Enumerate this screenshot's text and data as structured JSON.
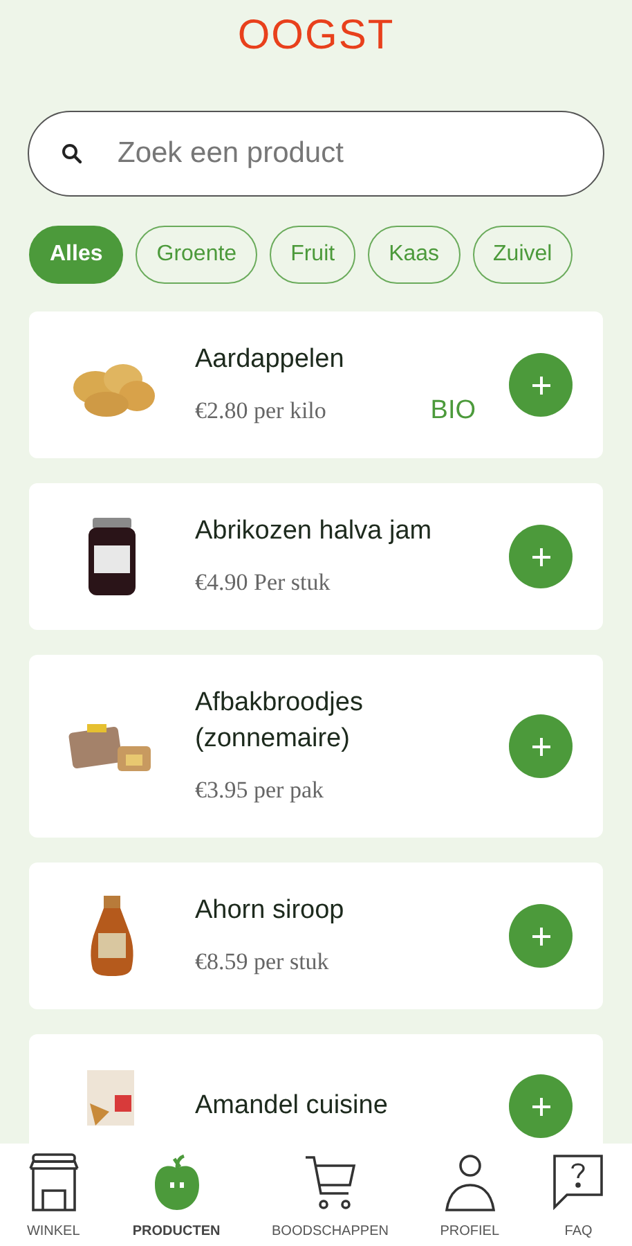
{
  "logo": "OOGST",
  "search": {
    "placeholder": "Zoek een product"
  },
  "filters": [
    {
      "label": "Alles",
      "selected": true
    },
    {
      "label": "Groente",
      "selected": false
    },
    {
      "label": "Fruit",
      "selected": false
    },
    {
      "label": "Kaas",
      "selected": false
    },
    {
      "label": "Zuivel",
      "selected": false
    }
  ],
  "products": [
    {
      "name": "Aardappelen",
      "price": "€2.80 per kilo",
      "badge": "BIO"
    },
    {
      "name": "Abrikozen halva jam",
      "price": "€4.90 Per stuk"
    },
    {
      "name": "Afbakbroodjes (zonnemaire)",
      "price": "€3.95 per pak"
    },
    {
      "name": "Ahorn siroop",
      "price": "€8.59 per stuk"
    },
    {
      "name": "Amandel cuisine"
    }
  ],
  "bottom_nav": [
    {
      "kind": "shop",
      "label": "WINKEL",
      "selected": false
    },
    {
      "kind": "apple",
      "label": "PRODUCTEN",
      "selected": true
    },
    {
      "kind": "cart",
      "label": "BOODSCHAPPEN",
      "selected": false
    },
    {
      "kind": "person",
      "label": "PROFIEL",
      "selected": false
    },
    {
      "kind": "faq",
      "label": "FAQ",
      "selected": false
    }
  ]
}
